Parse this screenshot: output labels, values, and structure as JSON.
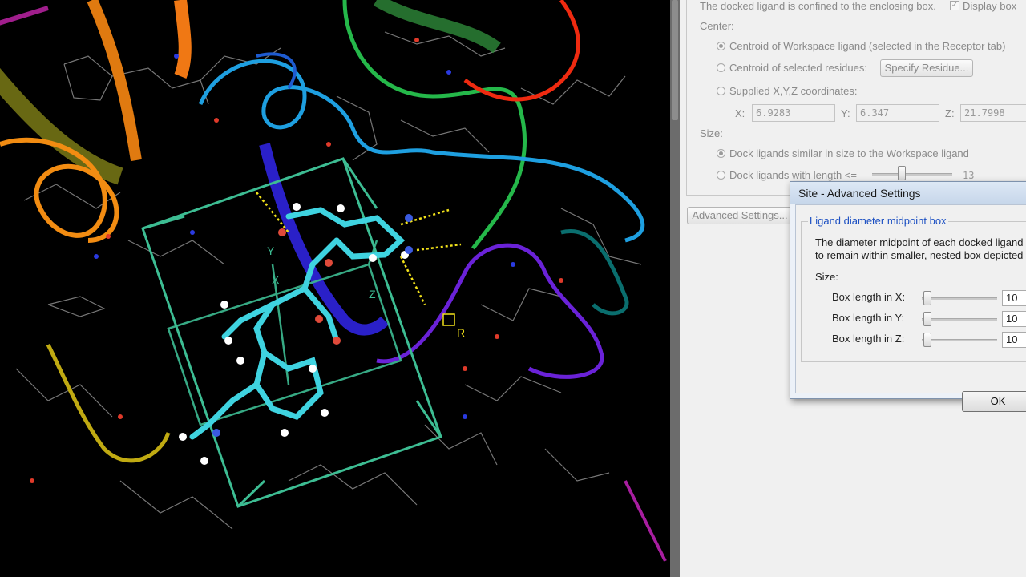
{
  "viewport": {
    "axis_labels": {
      "x": "X",
      "y": "Y",
      "z": "Z"
    },
    "residue_marker": "R",
    "colors": {
      "box": "#3dbd93",
      "ligand": "#3fd3e0",
      "backbone": "#1e90d8"
    }
  },
  "panel": {
    "confine_text": "The docked ligand is confined to the enclosing box.",
    "display_box_label": "Display box",
    "display_box_checked": true,
    "center_label": "Center:",
    "center_options": [
      {
        "label": "Centroid of Workspace ligand (selected in the Receptor tab)",
        "selected": true
      },
      {
        "label": "Centroid of selected residues:",
        "selected": false
      },
      {
        "label": "Supplied X,Y,Z coordinates:",
        "selected": false
      }
    ],
    "specify_residue_button": "Specify Residue...",
    "coords": {
      "x_label": "X:",
      "x": "6.9283",
      "y_label": "Y:",
      "y": "6.347",
      "z_label": "Z:",
      "z": "21.7998"
    },
    "size_label": "Size:",
    "size_options": [
      {
        "label": "Dock ligands similar in size to the Workspace ligand",
        "selected": true
      },
      {
        "label": "Dock ligands with length <=",
        "selected": false
      }
    ],
    "length_value": "13",
    "advanced_settings_button": "Advanced Settings..."
  },
  "dialog": {
    "title": "Site - Advanced Settings",
    "section_legend": "Ligand diameter midpoint box",
    "description_line1": "The diameter midpoint of each docked ligand",
    "description_line2": "to remain within smaller, nested box depicted",
    "size_label": "Size:",
    "sliders": [
      {
        "label": "Box length in X:",
        "value": "10"
      },
      {
        "label": "Box length in Y:",
        "value": "10"
      },
      {
        "label": "Box length in Z:",
        "value": "10"
      }
    ],
    "ok_button": "OK"
  }
}
